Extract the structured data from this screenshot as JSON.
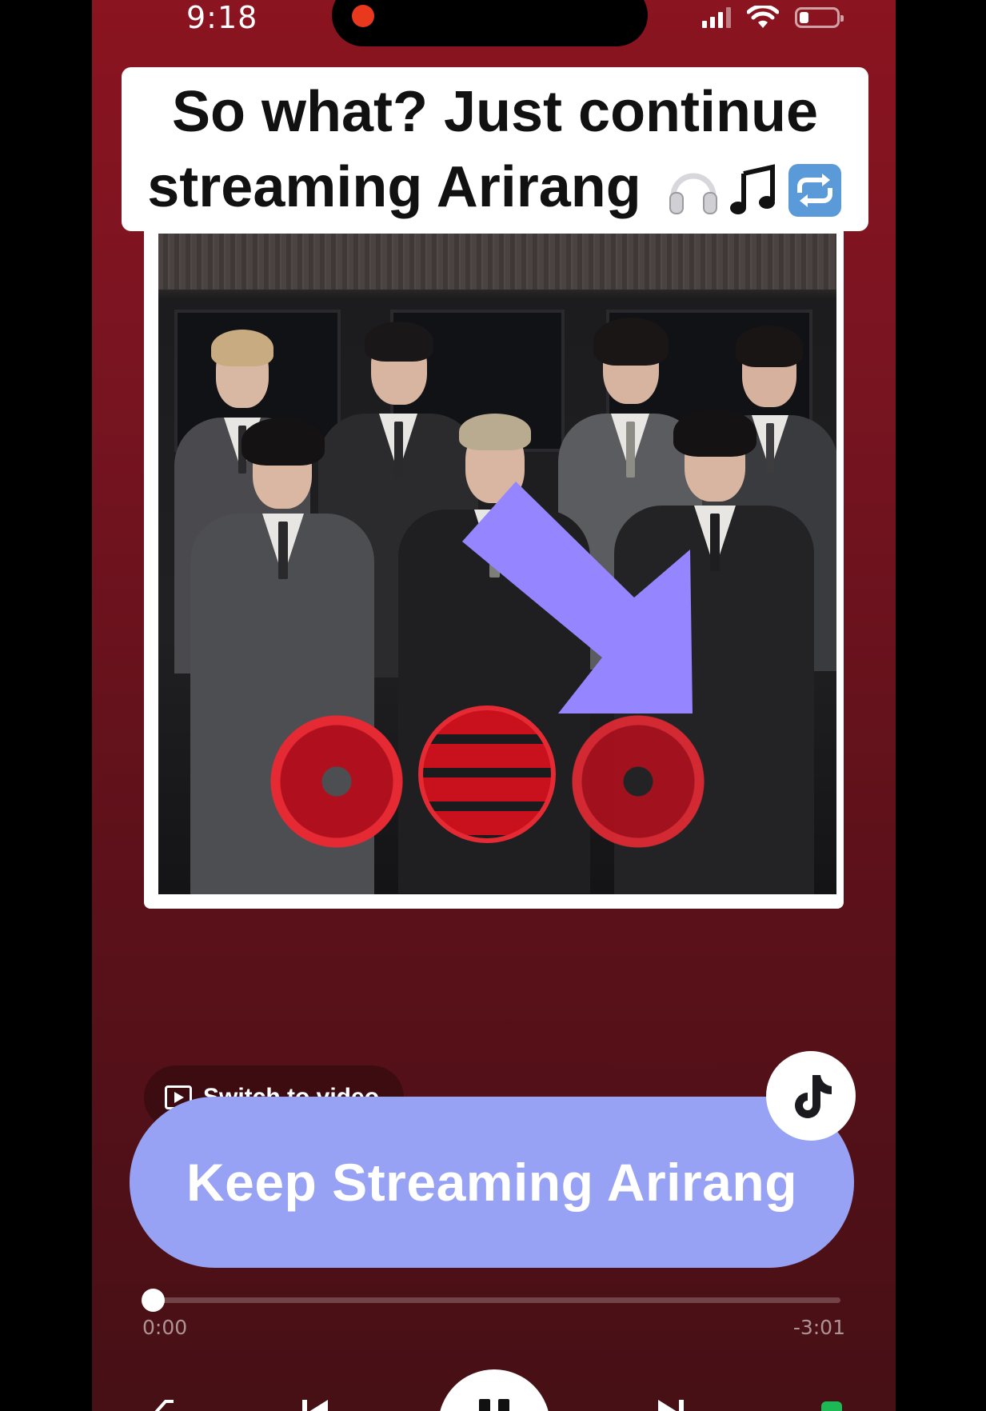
{
  "status_bar": {
    "time": "9:18"
  },
  "caption": {
    "line1": "So what? Just continue",
    "line2": "streaming Arirang",
    "emojis": [
      "headphones-emoji",
      "music-notes-emoji",
      "repeat-emoji"
    ]
  },
  "album": {
    "description_colors": {
      "accent_red": "#e62a34",
      "arrow": "#9585ff"
    }
  },
  "switch_video": {
    "label": "Switch to video"
  },
  "cta": {
    "label": "Keep Streaming Arirang"
  },
  "player": {
    "elapsed": "0:00",
    "remaining": "-3:01",
    "progress": 0.0
  },
  "colors": {
    "background_top": "#8a141f",
    "background_bottom": "#461015",
    "button": "#98a2f5"
  }
}
